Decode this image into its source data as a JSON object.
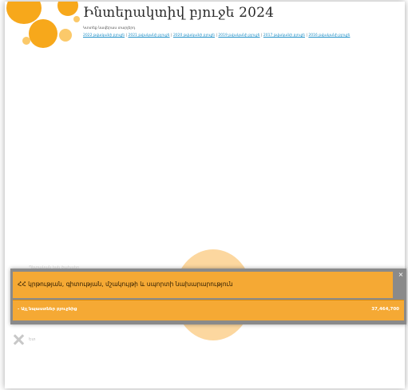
{
  "header": {
    "title": "Ինտերակտիվ բյուջե 2024",
    "subtitle": "Կտտեք նավերաս տարլերդ",
    "year_links": [
      "2022 թվականի բյուջե",
      "2021 թվականի բյուջե",
      "2020 թվականի բյուջե",
      "2019 թվականի բյուջե",
      "2017 թվականի բյուջե",
      "2016 թվականի բյուջե"
    ],
    "separator": " | "
  },
  "underlay": {
    "label": "Պետական եսե ծախսեր"
  },
  "popup": {
    "ministry": "ՀՀ կրթության, գիտության, մշակույթի և սպորտի նախարարություն",
    "row_label": "- Այլ նպաստներ բյուջեից",
    "row_value": "37,464,700",
    "close_glyph": "×"
  },
  "back": {
    "label": "Ետ"
  },
  "colors": {
    "accent": "#f5a934",
    "bubble": "#fcd79f",
    "link": "#1e8fc7"
  }
}
